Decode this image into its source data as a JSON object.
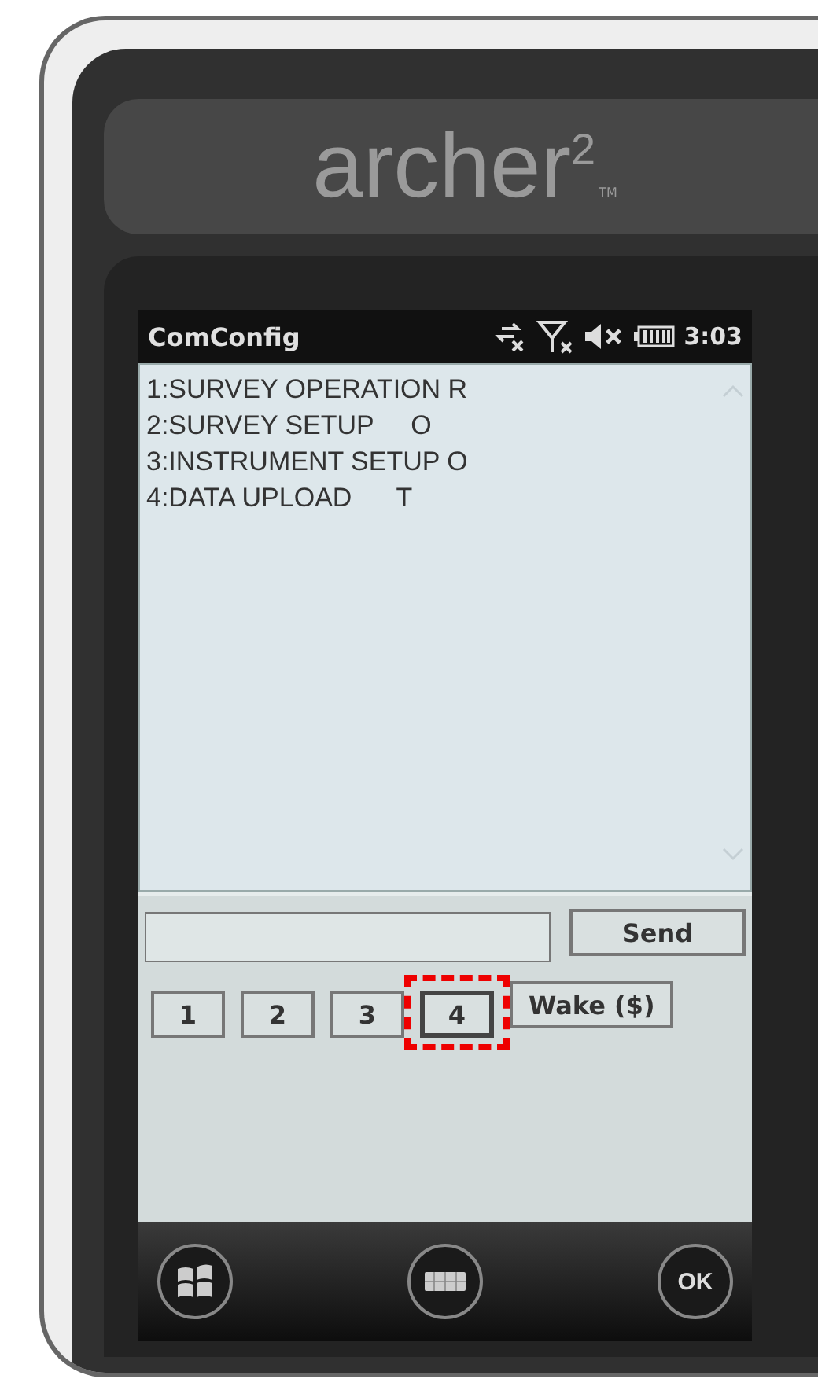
{
  "device_logo": {
    "text": "archer$^{2}$",
    "trademark": "TM"
  },
  "title_bar": {
    "title": "ComConfig",
    "time": "3:03"
  },
  "menu_lines": [
    "1:SURVEY OPERATION R",
    "2:SURVEY SETUP     O",
    "3:INSTRUMENT SETUP O",
    "4:DATA UPLOAD      T"
  ],
  "send_button": {
    "label": "Send"
  },
  "buttons": [
    {
      "label": "1",
      "focused": false,
      "highlighted": false
    },
    {
      "label": "2",
      "focused": false,
      "highlighted": false
    },
    {
      "label": "3",
      "focused": false,
      "highlighted": false
    },
    {
      "label": "4",
      "focused": true,
      "highlighted": true
    },
    {
      "label": "Wake ($)",
      "focused": false,
      "highlighted": false
    }
  ],
  "softkeys": [
    {
      "kind": "start"
    },
    {
      "kind": "keyboard"
    },
    {
      "kind": "ok",
      "label": "OK"
    }
  ]
}
